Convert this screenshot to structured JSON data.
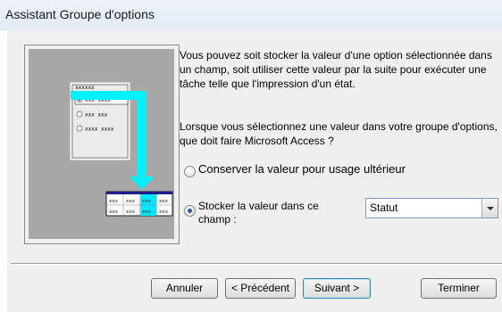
{
  "window": {
    "title": "Assistant Groupe d'options"
  },
  "illustration": {
    "group_label": "xxxxxx",
    "options": [
      "xxx xxxx",
      "xxx xxx",
      "xxxx xxxx"
    ],
    "table_row_1": [
      "xxx",
      "xxx",
      "xxx",
      "xxx"
    ],
    "table_row_2": [
      "xxx",
      "xxx",
      "xxx",
      "xxx"
    ]
  },
  "description": "Vous pouvez soit stocker la valeur d'une option sélectionnée dans un champ, soit utiliser cette valeur par la suite pour exécuter une tâche telle que l'impression d'un état.",
  "question": "Lorsque vous sélectionnez une valeur dans votre groupe d'options, que doit faire Microsoft Access ?",
  "options": {
    "keep_label": "Conserver la valeur pour usage ultérieur",
    "keep_selected": false,
    "store_label": "Stocker la valeur dans ce champ :",
    "store_selected": true
  },
  "field_combo": {
    "value": "Statut"
  },
  "buttons": {
    "cancel": "Annuler",
    "previous": "< Précédent",
    "next": "Suivant >",
    "finish": "Terminer"
  }
}
